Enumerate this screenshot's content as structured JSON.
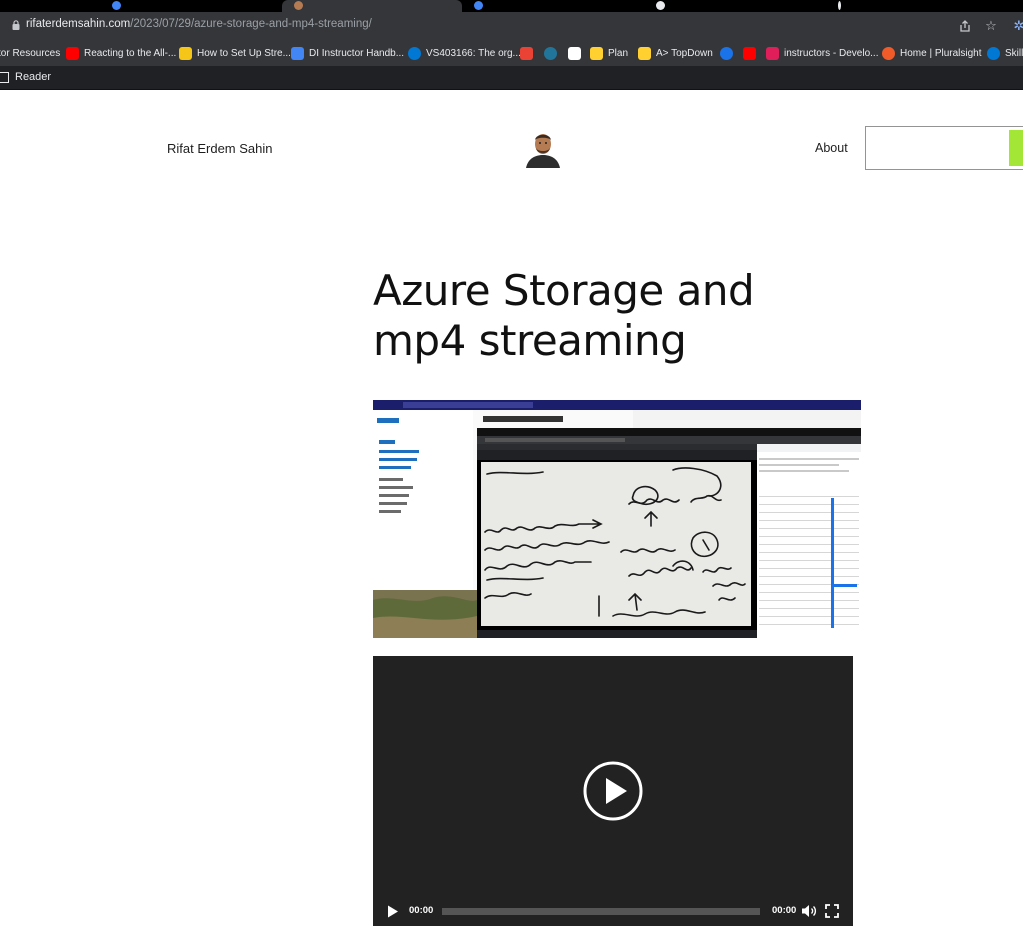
{
  "browser": {
    "url_host": "rifaterdemsahin.com",
    "url_path": "/2023/07/29/azure-storage-and-mp4-streaming/",
    "bookmarks": [
      {
        "label": "tor Resources",
        "color": ""
      },
      {
        "label": "Reacting to the All-...",
        "color": "#ff0000"
      },
      {
        "label": "How to Set Up Stre...",
        "color": "#f5c518"
      },
      {
        "label": "DI Instructor Handb...",
        "color": "#4285f4"
      },
      {
        "label": "VS403166: The org...",
        "color": "#0078d4"
      },
      {
        "label": "",
        "color": "#ea4335"
      },
      {
        "label": "",
        "color": "#21759b"
      },
      {
        "label": "",
        "color": "#ffffff"
      },
      {
        "label": "Plan",
        "color": "#ffd02f"
      },
      {
        "label": "A> TopDown",
        "color": "#ffd02f"
      },
      {
        "label": "",
        "color": "#1a73e8"
      },
      {
        "label": "",
        "color": "#ff0000"
      },
      {
        "label": "instructors - Develo...",
        "color": "#e01e5a"
      },
      {
        "label": "Home | Pluralsight",
        "color": "#f15b2a"
      },
      {
        "label": "Skills",
        "color": "#0078d4"
      }
    ],
    "reader_label": "Reader"
  },
  "site": {
    "title": "Rifat Erdem Sahin",
    "nav_about": "About",
    "search_placeholder": ""
  },
  "post": {
    "title": "Azure Storage and mp4 streaming",
    "video": {
      "current_time": "00:00",
      "duration": "00:00",
      "progress": 0
    }
  },
  "colors": {
    "accent_search": "#a3e635",
    "chrome_dark": "#35363a",
    "video_bg": "#222222"
  }
}
